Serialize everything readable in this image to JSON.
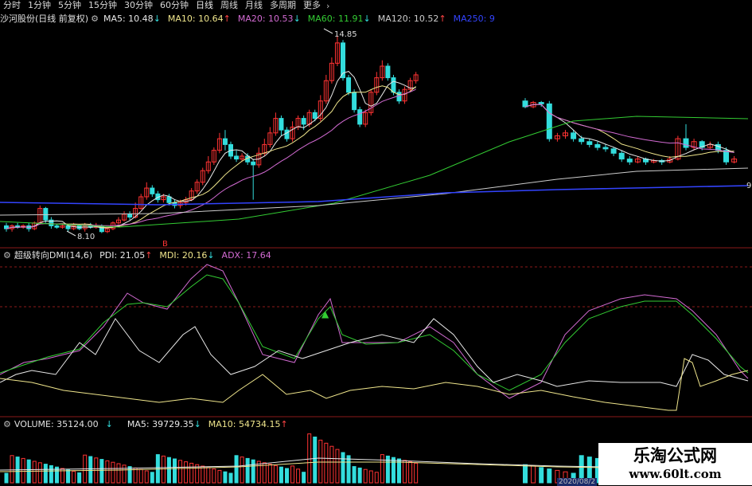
{
  "toolbar": {
    "periods": [
      "分时",
      "1分钟",
      "5分钟",
      "15分钟",
      "30分钟",
      "60分钟",
      "日线",
      "周线",
      "月线",
      "多周期",
      "更多"
    ],
    "active": "日线"
  },
  "main_panel": {
    "title": "沙河股份(日线 前复权)",
    "ma": [
      {
        "label": "MA5: 10.48",
        "arrow": "↓",
        "color": "#e8e8e8"
      },
      {
        "label": "MA10: 10.64",
        "arrow": "↑",
        "color": "#f0e68c"
      },
      {
        "label": "MA20: 10.53",
        "arrow": "↓",
        "color": "#d36bd3"
      },
      {
        "label": "MA60: 11.91",
        "arrow": "↓",
        "color": "#33cc33"
      },
      {
        "label": "MA120: 10.52",
        "arrow": "↑",
        "color": "#cccccc"
      },
      {
        "label": "MA250: 9",
        "arrow": "",
        "color": "#3344ff"
      }
    ],
    "annotations": {
      "high": "14.85",
      "low": "8.10",
      "right_edge": "9",
      "signal_letter": "B"
    }
  },
  "dmi_panel": {
    "title": "超级转向DMI(14,6)",
    "values": [
      {
        "label": "PDI: 21.05",
        "arrow": "↑",
        "color": "#e8e8e8"
      },
      {
        "label": "MDI: 20.16",
        "arrow": "↓",
        "color": "#f0e68c"
      },
      {
        "label": "ADX: 17.64",
        "arrow": "",
        "color": "#d36bd3"
      }
    ]
  },
  "volume_panel": {
    "title": "VOLUME: 35124.00",
    "arrow": "↓",
    "values": [
      {
        "label": "MA5: 39729.35",
        "arrow": "↓",
        "color": "#e8e8e8"
      },
      {
        "label": "MA10: 54734.15",
        "arrow": "↑",
        "color": "#f0e68c"
      }
    ],
    "date_label": "2020/08/2"
  },
  "watermark": {
    "title": "乐淘公式网",
    "url": "www.60lt.com"
  },
  "colors": {
    "up": "#ff3333",
    "down": "#33dddd",
    "grid": "#8b1a1a"
  },
  "chart_data": {
    "type": "candlestick",
    "price_range": [
      7.9,
      15.2
    ],
    "candles": [
      {
        "o": 8.3,
        "c": 8.2,
        "h": 8.4,
        "l": 8.1
      },
      {
        "o": 8.2,
        "c": 8.3,
        "h": 8.35,
        "l": 8.1
      },
      {
        "o": 8.3,
        "c": 8.25,
        "h": 8.4,
        "l": 8.2
      },
      {
        "o": 8.25,
        "c": 8.3,
        "h": 8.35,
        "l": 8.2
      },
      {
        "o": 8.3,
        "c": 8.2,
        "h": 8.4,
        "l": 8.1
      },
      {
        "o": 8.2,
        "c": 8.4,
        "h": 8.45,
        "l": 8.15
      },
      {
        "o": 8.4,
        "c": 8.9,
        "h": 9.0,
        "l": 8.35
      },
      {
        "o": 8.9,
        "c": 8.5,
        "h": 8.95,
        "l": 8.4
      },
      {
        "o": 8.5,
        "c": 8.3,
        "h": 8.6,
        "l": 8.2
      },
      {
        "o": 8.3,
        "c": 8.25,
        "h": 8.35,
        "l": 8.2
      },
      {
        "o": 8.25,
        "c": 8.3,
        "h": 8.35,
        "l": 8.2
      },
      {
        "o": 8.3,
        "c": 8.2,
        "h": 8.35,
        "l": 8.1
      },
      {
        "o": 8.2,
        "c": 8.3,
        "h": 8.4,
        "l": 8.15
      },
      {
        "o": 8.3,
        "c": 8.2,
        "h": 8.35,
        "l": 8.15
      },
      {
        "o": 8.2,
        "c": 8.3,
        "h": 8.4,
        "l": 8.1
      },
      {
        "o": 8.3,
        "c": 8.25,
        "h": 8.4,
        "l": 8.2
      },
      {
        "o": 8.25,
        "c": 8.3,
        "h": 8.4,
        "l": 8.2
      },
      {
        "o": 8.3,
        "c": 8.1,
        "h": 8.35,
        "l": 8.05
      },
      {
        "o": 8.1,
        "c": 8.2,
        "h": 8.25,
        "l": 8.05
      },
      {
        "o": 8.2,
        "c": 8.4,
        "h": 8.45,
        "l": 8.15
      },
      {
        "o": 8.4,
        "c": 8.5,
        "h": 8.6,
        "l": 8.35
      },
      {
        "o": 8.5,
        "c": 8.7,
        "h": 8.8,
        "l": 8.45
      },
      {
        "o": 8.7,
        "c": 8.6,
        "h": 8.8,
        "l": 8.5
      },
      {
        "o": 8.6,
        "c": 8.9,
        "h": 9.1,
        "l": 8.55
      },
      {
        "o": 8.9,
        "c": 9.3,
        "h": 9.4,
        "l": 8.85
      },
      {
        "o": 9.3,
        "c": 9.6,
        "h": 9.8,
        "l": 9.2
      },
      {
        "o": 9.6,
        "c": 9.4,
        "h": 9.7,
        "l": 9.3
      },
      {
        "o": 9.4,
        "c": 9.2,
        "h": 9.5,
        "l": 9.1
      },
      {
        "o": 9.2,
        "c": 9.3,
        "h": 9.4,
        "l": 9.1
      },
      {
        "o": 9.3,
        "c": 9.1,
        "h": 9.4,
        "l": 9.0
      },
      {
        "o": 9.1,
        "c": 9.0,
        "h": 9.2,
        "l": 8.9
      },
      {
        "o": 9.0,
        "c": 9.1,
        "h": 9.2,
        "l": 8.9
      },
      {
        "o": 9.1,
        "c": 9.2,
        "h": 9.3,
        "l": 9.0
      },
      {
        "o": 9.2,
        "c": 9.5,
        "h": 9.6,
        "l": 9.15
      },
      {
        "o": 9.5,
        "c": 9.8,
        "h": 9.9,
        "l": 9.4
      },
      {
        "o": 9.8,
        "c": 10.2,
        "h": 10.3,
        "l": 9.7
      },
      {
        "o": 10.2,
        "c": 10.5,
        "h": 10.7,
        "l": 10.1
      },
      {
        "o": 10.5,
        "c": 10.9,
        "h": 11.0,
        "l": 10.4
      },
      {
        "o": 10.9,
        "c": 11.3,
        "h": 11.5,
        "l": 10.8
      },
      {
        "o": 11.3,
        "c": 11.1,
        "h": 11.6,
        "l": 10.9
      },
      {
        "o": 11.1,
        "c": 10.7,
        "h": 11.2,
        "l": 10.6
      },
      {
        "o": 10.7,
        "c": 10.6,
        "h": 10.9,
        "l": 10.5
      },
      {
        "o": 10.6,
        "c": 10.7,
        "h": 10.8,
        "l": 10.5
      },
      {
        "o": 10.7,
        "c": 10.5,
        "h": 10.8,
        "l": 10.4
      },
      {
        "o": 10.5,
        "c": 10.4,
        "h": 10.6,
        "l": 9.2
      },
      {
        "o": 10.4,
        "c": 10.8,
        "h": 11.0,
        "l": 10.3
      },
      {
        "o": 10.8,
        "c": 11.1,
        "h": 11.3,
        "l": 10.7
      },
      {
        "o": 11.1,
        "c": 11.5,
        "h": 11.7,
        "l": 11.0
      },
      {
        "o": 11.5,
        "c": 12.0,
        "h": 12.2,
        "l": 11.4
      },
      {
        "o": 12.0,
        "c": 11.6,
        "h": 12.1,
        "l": 11.4
      },
      {
        "o": 11.6,
        "c": 11.3,
        "h": 11.7,
        "l": 11.2
      },
      {
        "o": 11.3,
        "c": 11.7,
        "h": 11.9,
        "l": 11.2
      },
      {
        "o": 11.7,
        "c": 12.0,
        "h": 12.1,
        "l": 11.6
      },
      {
        "o": 12.0,
        "c": 11.8,
        "h": 12.1,
        "l": 11.6
      },
      {
        "o": 11.8,
        "c": 12.2,
        "h": 12.3,
        "l": 11.7
      },
      {
        "o": 12.2,
        "c": 12.0,
        "h": 12.3,
        "l": 11.9
      },
      {
        "o": 12.0,
        "c": 12.6,
        "h": 12.8,
        "l": 11.9
      },
      {
        "o": 12.6,
        "c": 13.3,
        "h": 13.5,
        "l": 12.5
      },
      {
        "o": 13.3,
        "c": 13.9,
        "h": 14.1,
        "l": 13.2
      },
      {
        "o": 13.9,
        "c": 14.6,
        "h": 14.85,
        "l": 13.8
      },
      {
        "o": 14.6,
        "c": 13.4,
        "h": 14.7,
        "l": 13.3
      },
      {
        "o": 13.4,
        "c": 12.9,
        "h": 13.5,
        "l": 12.8
      },
      {
        "o": 12.9,
        "c": 12.3,
        "h": 13.0,
        "l": 12.2
      },
      {
        "o": 12.3,
        "c": 11.8,
        "h": 12.4,
        "l": 11.7
      },
      {
        "o": 11.8,
        "c": 12.2,
        "h": 12.3,
        "l": 11.7
      },
      {
        "o": 12.2,
        "c": 12.9,
        "h": 13.0,
        "l": 12.1
      },
      {
        "o": 12.9,
        "c": 13.4,
        "h": 13.6,
        "l": 12.8
      },
      {
        "o": 13.4,
        "c": 13.8,
        "h": 14.0,
        "l": 13.3
      },
      {
        "o": 13.8,
        "c": 13.4,
        "h": 13.9,
        "l": 13.3
      },
      {
        "o": 13.4,
        "c": 12.9,
        "h": 13.5,
        "l": 12.8
      },
      {
        "o": 12.9,
        "c": 12.6,
        "h": 13.0,
        "l": 12.5
      },
      {
        "o": 12.6,
        "c": 13.0,
        "h": 13.1,
        "l": 12.5
      },
      {
        "o": 13.0,
        "c": 13.3,
        "h": 13.4,
        "l": 12.9
      },
      {
        "o": 13.3,
        "c": 13.5,
        "h": 13.6,
        "l": 13.2
      }
    ],
    "candles2": [
      {
        "o": 12.6,
        "c": 12.4,
        "h": 12.7,
        "l": 12.35
      },
      {
        "o": 12.4,
        "c": 12.55,
        "h": 12.6,
        "l": 12.35
      },
      {
        "o": 12.55,
        "c": 12.5,
        "h": 12.6,
        "l": 12.4
      },
      {
        "o": 12.5,
        "c": 11.3,
        "h": 12.6,
        "l": 11.2
      },
      {
        "o": 11.3,
        "c": 11.4,
        "h": 11.5,
        "l": 11.2
      },
      {
        "o": 11.4,
        "c": 11.5,
        "h": 11.6,
        "l": 11.3
      },
      {
        "o": 11.5,
        "c": 11.3,
        "h": 11.6,
        "l": 11.2
      },
      {
        "o": 11.3,
        "c": 11.2,
        "h": 11.4,
        "l": 11.1
      },
      {
        "o": 11.2,
        "c": 11.1,
        "h": 11.3,
        "l": 11.0
      },
      {
        "o": 11.1,
        "c": 11.0,
        "h": 11.2,
        "l": 10.9
      },
      {
        "o": 11.0,
        "c": 10.95,
        "h": 11.1,
        "l": 10.85
      },
      {
        "o": 10.95,
        "c": 10.8,
        "h": 11.0,
        "l": 10.7
      },
      {
        "o": 10.8,
        "c": 10.6,
        "h": 10.9,
        "l": 10.5
      },
      {
        "o": 10.6,
        "c": 10.5,
        "h": 10.7,
        "l": 10.4
      },
      {
        "o": 10.5,
        "c": 10.6,
        "h": 10.7,
        "l": 10.45
      },
      {
        "o": 10.6,
        "c": 10.5,
        "h": 10.65,
        "l": 10.4
      },
      {
        "o": 10.5,
        "c": 10.55,
        "h": 10.6,
        "l": 10.45
      },
      {
        "o": 10.55,
        "c": 10.5,
        "h": 10.6,
        "l": 10.4
      },
      {
        "o": 10.5,
        "c": 10.6,
        "h": 10.7,
        "l": 10.45
      },
      {
        "o": 10.6,
        "c": 11.3,
        "h": 11.4,
        "l": 10.55
      },
      {
        "o": 11.3,
        "c": 11.0,
        "h": 11.8,
        "l": 10.9
      },
      {
        "o": 11.0,
        "c": 11.2,
        "h": 11.3,
        "l": 10.9
      },
      {
        "o": 11.2,
        "c": 11.0,
        "h": 11.25,
        "l": 10.9
      },
      {
        "o": 11.0,
        "c": 11.1,
        "h": 11.2,
        "l": 10.95
      },
      {
        "o": 11.1,
        "c": 10.9,
        "h": 11.2,
        "l": 10.8
      },
      {
        "o": 10.9,
        "c": 10.5,
        "h": 11.0,
        "l": 10.4
      },
      {
        "o": 10.5,
        "c": 10.6,
        "h": 10.7,
        "l": 10.45
      }
    ]
  }
}
